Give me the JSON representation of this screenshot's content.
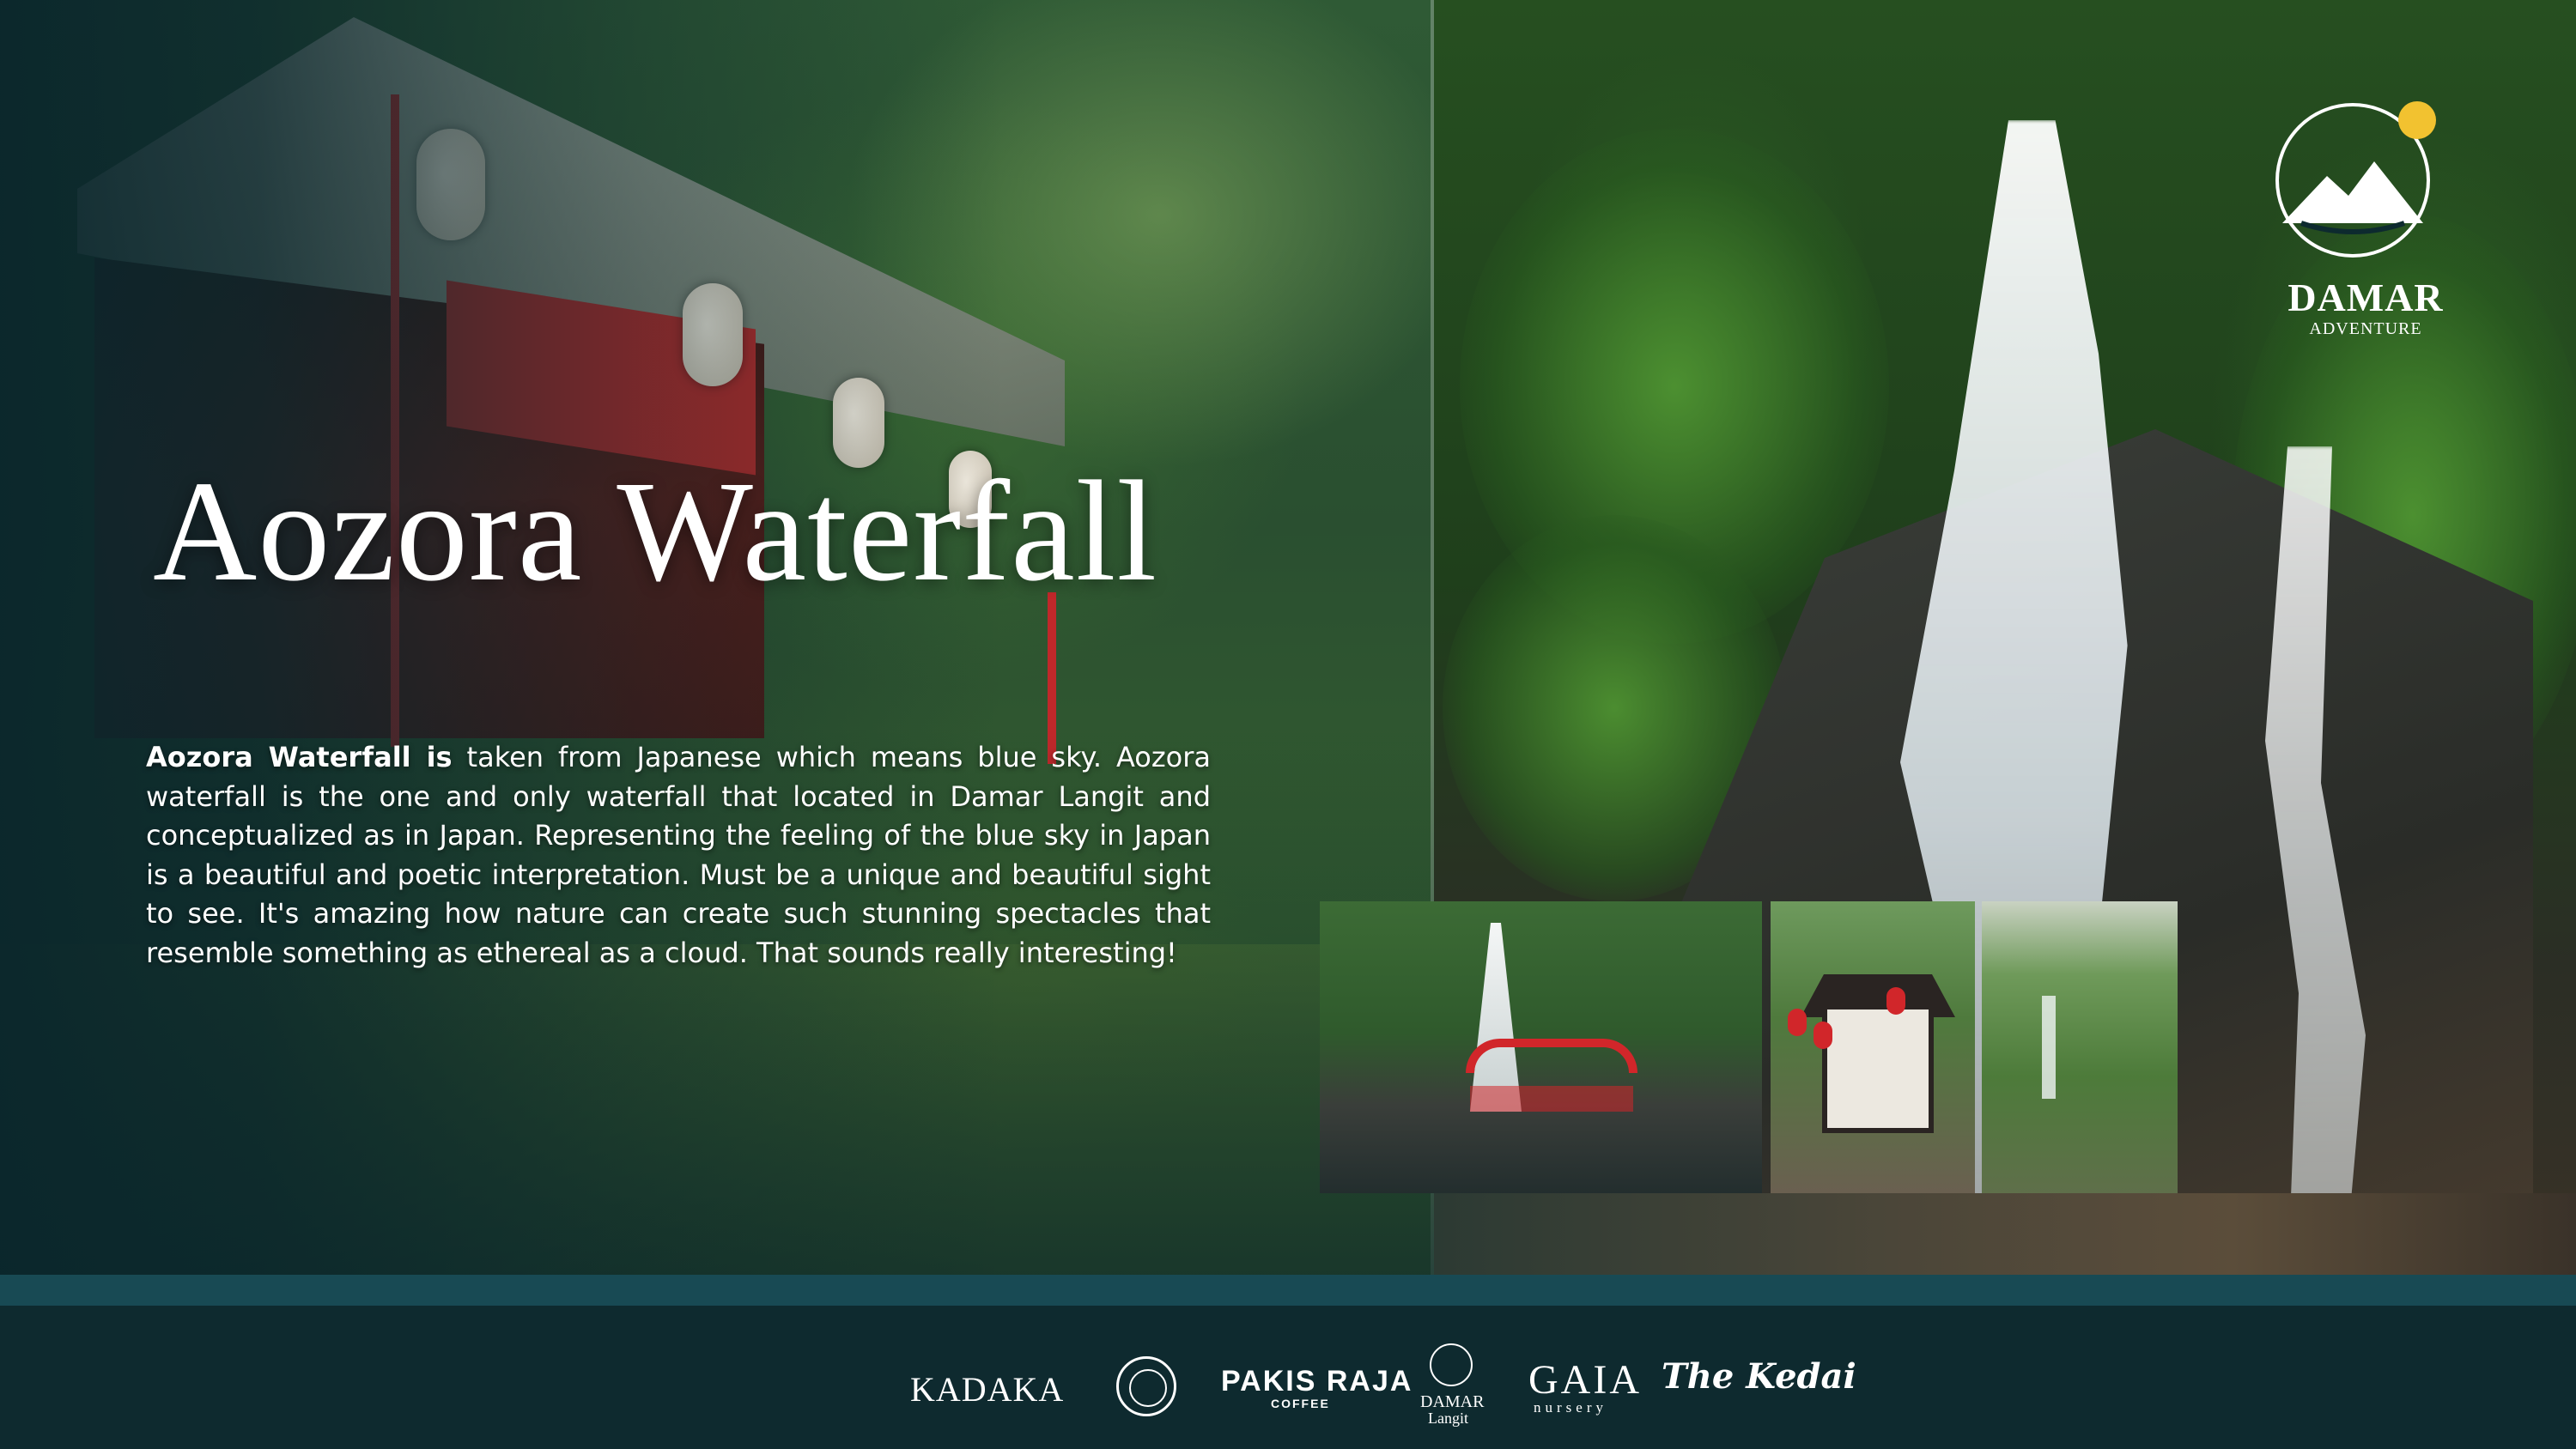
{
  "slide": {
    "title": "Aozora Waterfall",
    "description_lead": "Aozora Waterfall is",
    "description_rest": " taken from Japanese which means blue sky. Aozora waterfall is the one and only waterfall that located in Damar Langit and conceptualized as in Japan. Representing the feeling of the blue sky in Japan is a beautiful and poetic interpretation. Must be a unique and beautiful sight to see. It's amazing how nature can create such stunning spectacles that resemble something as ethereal as a cloud. That sounds really interesting!"
  },
  "brand": {
    "name": "DAMAR",
    "tagline": "ADVENTURE"
  },
  "partners": {
    "kadaka": "KADAKA",
    "pakis_raja": "PAKIS RAJA",
    "pakis_raja_sub": "COFFEE",
    "damar_langit": "DAMAR",
    "damar_langit_sub": "Langit",
    "gaia": "GAIA",
    "gaia_sub": "nursery",
    "the_kedai": "The Kedai"
  },
  "colors": {
    "background": "#0d2a2f",
    "accent_band": "#184a54",
    "text": "#ffffff"
  }
}
